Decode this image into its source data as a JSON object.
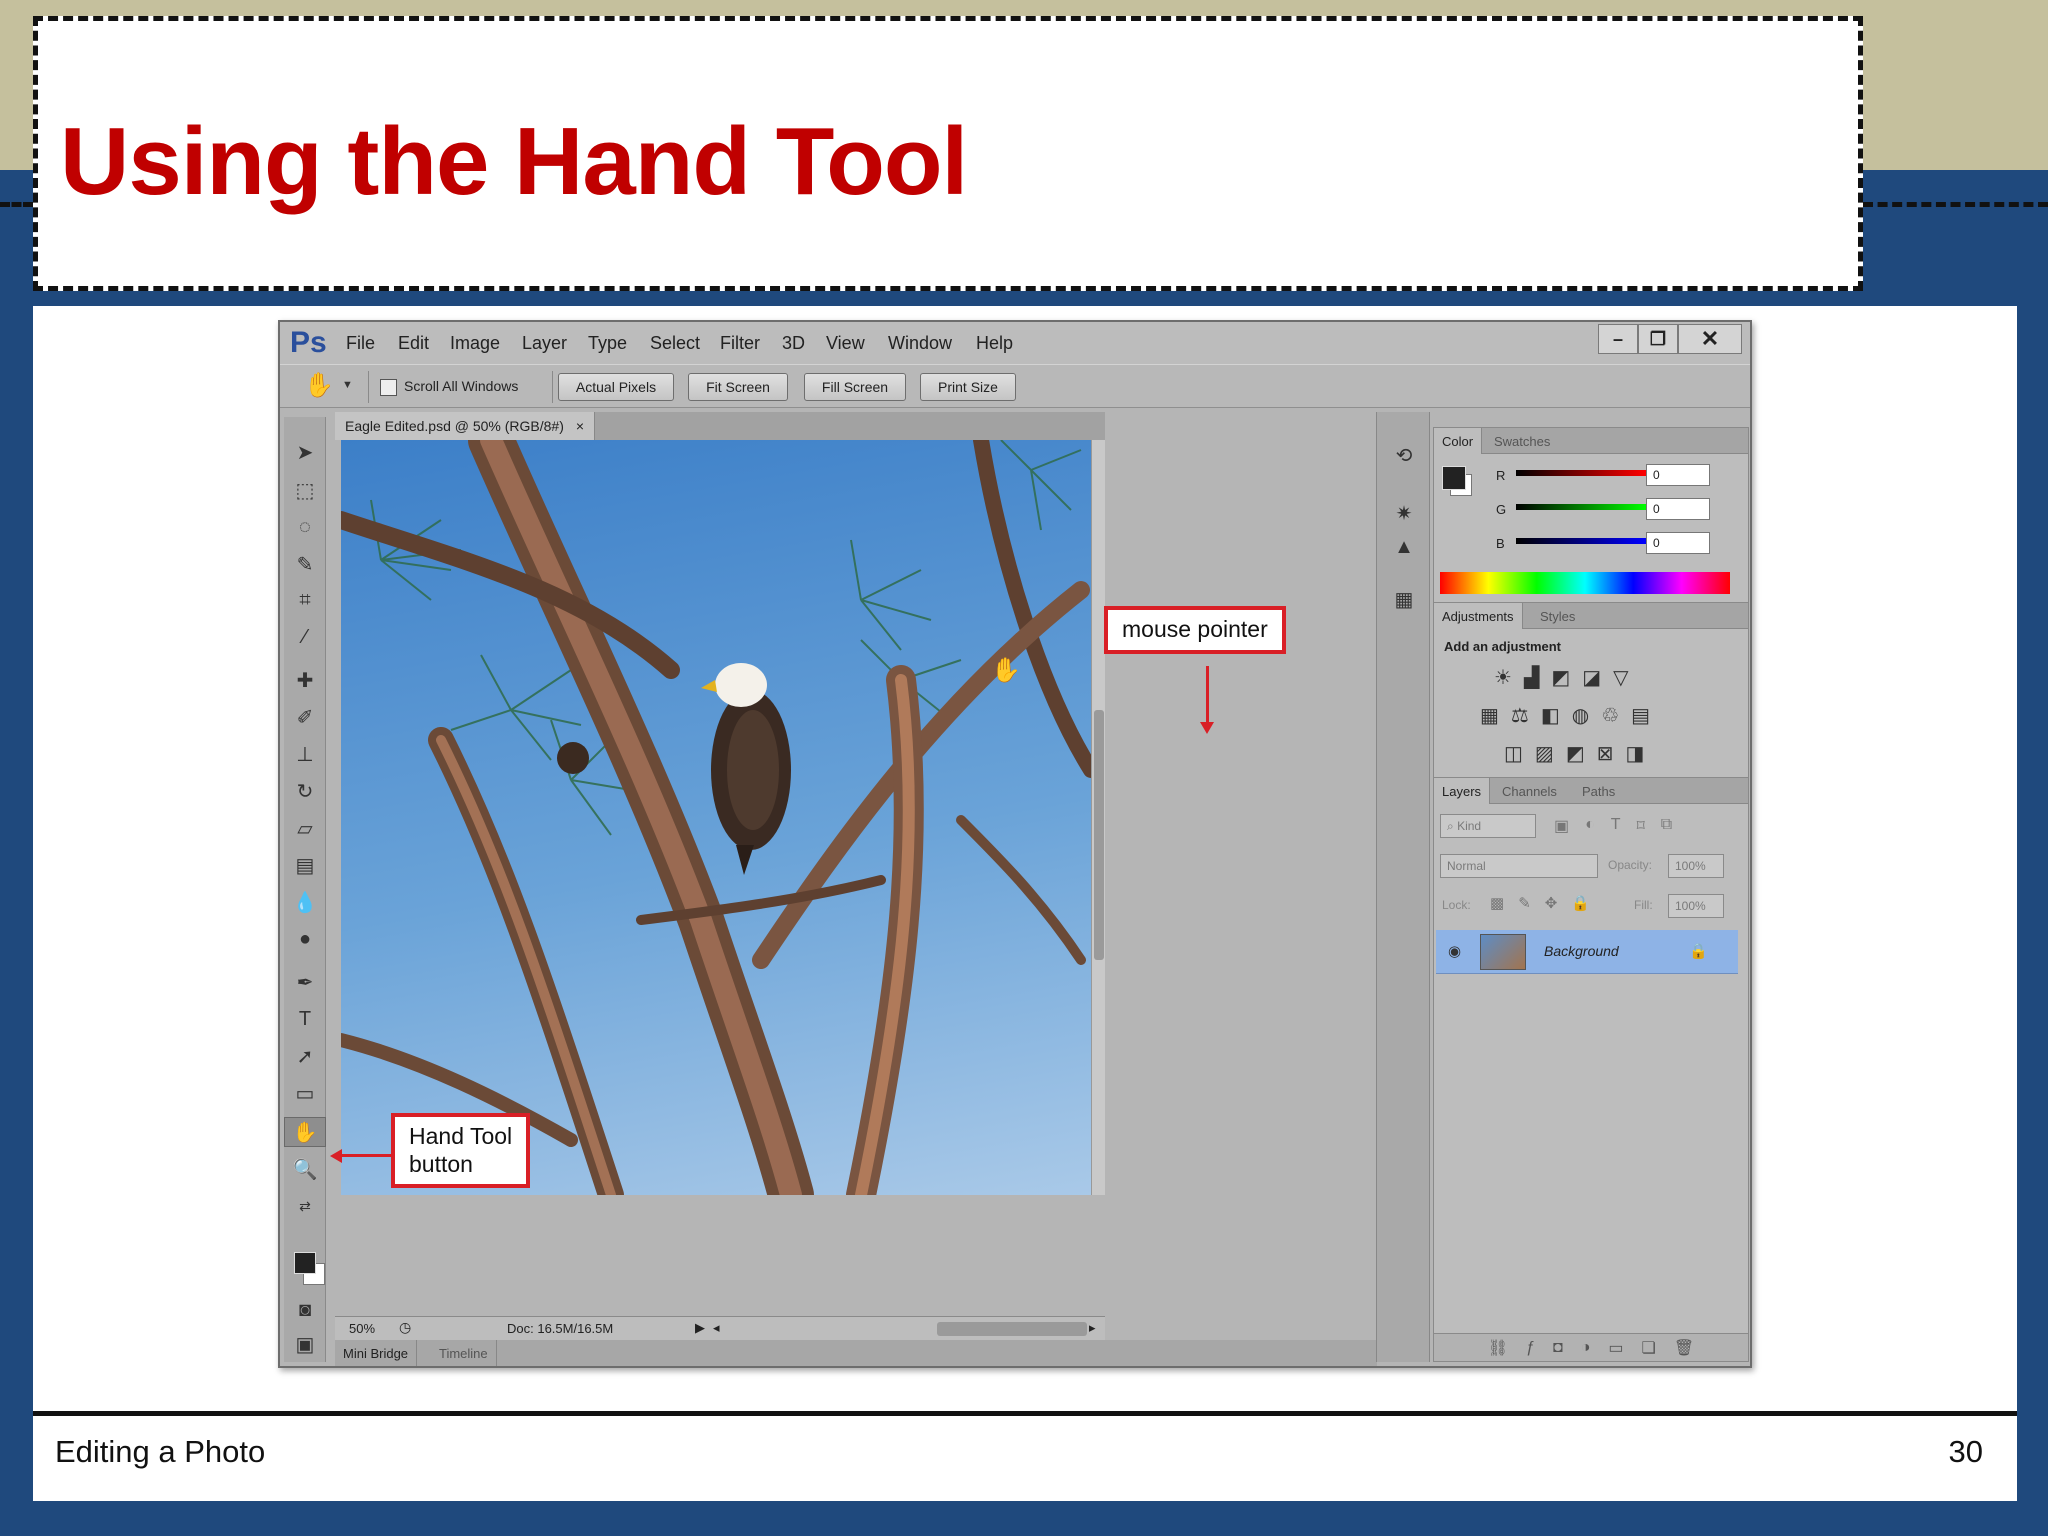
{
  "slide": {
    "title": "Using the Hand Tool",
    "footer_left": "Editing a Photo",
    "page_number": "30"
  },
  "app": {
    "logo": "Ps",
    "menu": [
      "File",
      "Edit",
      "Image",
      "Layer",
      "Type",
      "Select",
      "Filter",
      "3D",
      "View",
      "Window",
      "Help"
    ],
    "window_buttons": {
      "minimize": "–",
      "restore": "❐",
      "close": "✕"
    }
  },
  "options_bar": {
    "tool_icon": "hand-icon",
    "scroll_all_windows": "Scroll All Windows",
    "buttons": [
      "Actual Pixels",
      "Fit Screen",
      "Fill Screen",
      "Print Size"
    ]
  },
  "document": {
    "tab_title": "Eagle Edited.psd @ 50% (RGB/8#)",
    "tab_close": "×",
    "zoom": "50%",
    "doc_size": "Doc: 16.5M/16.5M"
  },
  "bottom_tabs": [
    "Mini Bridge",
    "Timeline"
  ],
  "color_panel": {
    "tabs": [
      "Color",
      "Swatches"
    ],
    "r_label": "R",
    "g_label": "G",
    "b_label": "B",
    "r": "0",
    "g": "0",
    "b": "0"
  },
  "adjustments_panel": {
    "tabs": [
      "Adjustments",
      "Styles"
    ],
    "heading": "Add an adjustment"
  },
  "layers_panel": {
    "tabs": [
      "Layers",
      "Channels",
      "Paths"
    ],
    "kind": "Kind",
    "blend_mode": "Normal",
    "opacity_label": "Opacity:",
    "opacity": "100%",
    "lock_label": "Lock:",
    "fill_label": "Fill:",
    "fill": "100%",
    "layer_name": "Background"
  },
  "callouts": {
    "mouse_pointer": "mouse pointer",
    "hand_tool_line1": "Hand Tool",
    "hand_tool_line2": "button"
  },
  "colors": {
    "title_red": "#c00000",
    "callout_red": "#d91f26",
    "slide_blue": "#1f497d",
    "slide_tan": "#c5c09d"
  }
}
